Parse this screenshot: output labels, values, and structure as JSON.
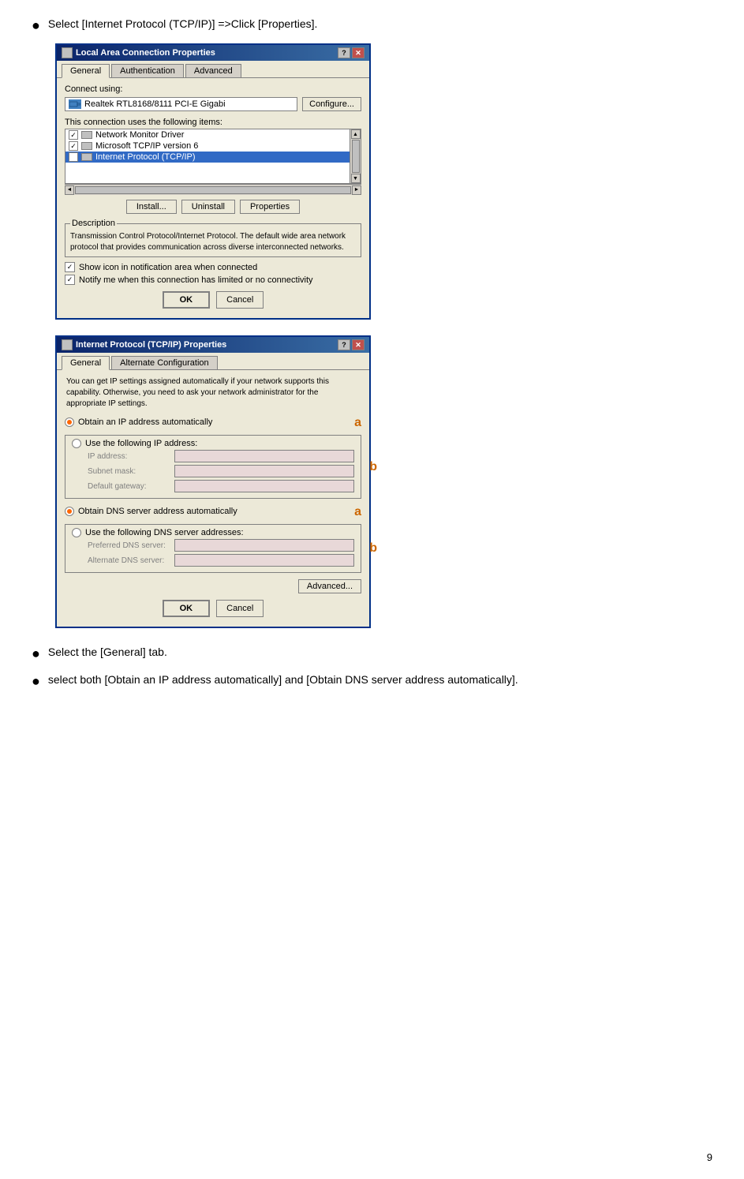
{
  "bullet1": {
    "text": "Select [Internet Protocol (TCP/IP)] =>Click [Properties]."
  },
  "dialog1": {
    "title": "Local Area Connection Properties",
    "tabs": [
      "General",
      "Authentication",
      "Advanced"
    ],
    "connect_using_label": "Connect using:",
    "adapter_name": "Realtek RTL8168/8111 PCI-E Gigabi",
    "configure_btn": "Configure...",
    "items_label": "This connection uses the following items:",
    "items": [
      {
        "checked": true,
        "name": "Network Monitor Driver",
        "selected": false
      },
      {
        "checked": true,
        "name": "Microsoft TCP/IP version 6",
        "selected": false
      },
      {
        "checked": true,
        "name": "Internet Protocol (TCP/IP)",
        "selected": true
      }
    ],
    "install_btn": "Install...",
    "uninstall_btn": "Uninstall",
    "properties_btn": "Properties",
    "description_label": "Description",
    "description_text": "Transmission Control Protocol/Internet Protocol. The default wide area network protocol that provides communication across diverse interconnected networks.",
    "checkbox1_label": "Show icon in notification area when connected",
    "checkbox1_checked": true,
    "checkbox2_label": "Notify me when this connection has limited or no connectivity",
    "checkbox2_checked": true,
    "ok_btn": "OK",
    "cancel_btn": "Cancel"
  },
  "dialog2": {
    "title": "Internet Protocol (TCP/IP) Properties",
    "tabs": [
      "General",
      "Alternate Configuration"
    ],
    "info_text": "You can get IP settings assigned automatically if your network supports this capability. Otherwise, you need to ask your network administrator for the appropriate IP settings.",
    "radio1_label": "Obtain an IP address automatically",
    "radio1_selected": true,
    "radio2_label": "Use the following IP address:",
    "radio2_selected": false,
    "ip_address_label": "IP address:",
    "subnet_mask_label": "Subnet mask:",
    "default_gateway_label": "Default gateway:",
    "radio3_label": "Obtain DNS server address automatically",
    "radio3_selected": true,
    "radio4_label": "Use the following DNS server addresses:",
    "radio4_selected": false,
    "preferred_dns_label": "Preferred DNS server:",
    "alternate_dns_label": "Alternate DNS server:",
    "advanced_btn": "Advanced...",
    "ok_btn": "OK",
    "cancel_btn": "Cancel"
  },
  "bullet2": {
    "text": "Select the [General] tab."
  },
  "bullet3": {
    "text": "select both [Obtain an IP address automatically] and [Obtain DNS server address automatically]."
  },
  "page_number": "9",
  "annotations": {
    "a": "a",
    "b": "b"
  }
}
